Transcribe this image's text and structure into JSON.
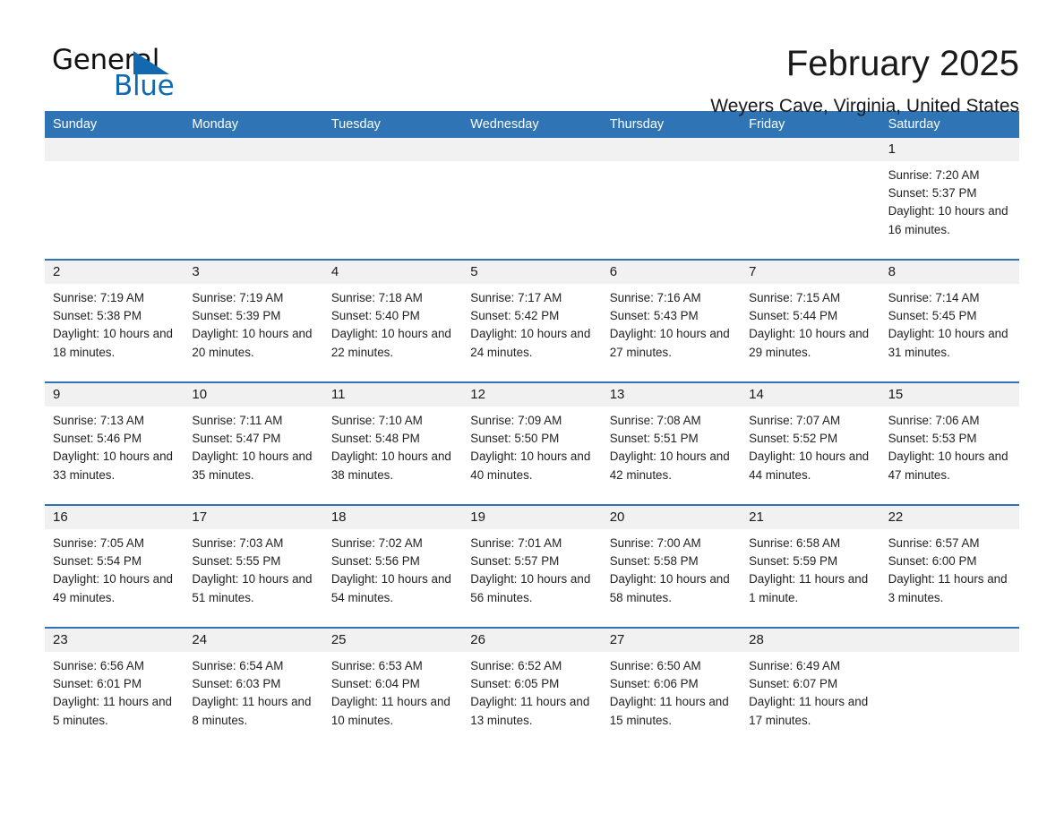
{
  "brand": {
    "name_part1": "General",
    "name_part2": "Blue",
    "logo_icon": "triangle-flag-icon",
    "accent_color": "#1269b0"
  },
  "header": {
    "title": "February 2025",
    "subtitle": "Weyers Cave, Virginia, United States"
  },
  "theme": {
    "header_row_bg": "#2f74b5",
    "day_number_bg": "#f1f1f1",
    "row_divider": "#2f74b5",
    "text": "#1a1a1a"
  },
  "weekdays": [
    "Sunday",
    "Monday",
    "Tuesday",
    "Wednesday",
    "Thursday",
    "Friday",
    "Saturday"
  ],
  "weeks": [
    [
      {
        "day": "",
        "empty": true
      },
      {
        "day": "",
        "empty": true
      },
      {
        "day": "",
        "empty": true
      },
      {
        "day": "",
        "empty": true
      },
      {
        "day": "",
        "empty": true
      },
      {
        "day": "",
        "empty": true
      },
      {
        "day": "1",
        "sunrise": "Sunrise: 7:20 AM",
        "sunset": "Sunset: 5:37 PM",
        "daylight": "Daylight: 10 hours and 16 minutes."
      }
    ],
    [
      {
        "day": "2",
        "sunrise": "Sunrise: 7:19 AM",
        "sunset": "Sunset: 5:38 PM",
        "daylight": "Daylight: 10 hours and 18 minutes."
      },
      {
        "day": "3",
        "sunrise": "Sunrise: 7:19 AM",
        "sunset": "Sunset: 5:39 PM",
        "daylight": "Daylight: 10 hours and 20 minutes."
      },
      {
        "day": "4",
        "sunrise": "Sunrise: 7:18 AM",
        "sunset": "Sunset: 5:40 PM",
        "daylight": "Daylight: 10 hours and 22 minutes."
      },
      {
        "day": "5",
        "sunrise": "Sunrise: 7:17 AM",
        "sunset": "Sunset: 5:42 PM",
        "daylight": "Daylight: 10 hours and 24 minutes."
      },
      {
        "day": "6",
        "sunrise": "Sunrise: 7:16 AM",
        "sunset": "Sunset: 5:43 PM",
        "daylight": "Daylight: 10 hours and 27 minutes."
      },
      {
        "day": "7",
        "sunrise": "Sunrise: 7:15 AM",
        "sunset": "Sunset: 5:44 PM",
        "daylight": "Daylight: 10 hours and 29 minutes."
      },
      {
        "day": "8",
        "sunrise": "Sunrise: 7:14 AM",
        "sunset": "Sunset: 5:45 PM",
        "daylight": "Daylight: 10 hours and 31 minutes."
      }
    ],
    [
      {
        "day": "9",
        "sunrise": "Sunrise: 7:13 AM",
        "sunset": "Sunset: 5:46 PM",
        "daylight": "Daylight: 10 hours and 33 minutes."
      },
      {
        "day": "10",
        "sunrise": "Sunrise: 7:11 AM",
        "sunset": "Sunset: 5:47 PM",
        "daylight": "Daylight: 10 hours and 35 minutes."
      },
      {
        "day": "11",
        "sunrise": "Sunrise: 7:10 AM",
        "sunset": "Sunset: 5:48 PM",
        "daylight": "Daylight: 10 hours and 38 minutes."
      },
      {
        "day": "12",
        "sunrise": "Sunrise: 7:09 AM",
        "sunset": "Sunset: 5:50 PM",
        "daylight": "Daylight: 10 hours and 40 minutes."
      },
      {
        "day": "13",
        "sunrise": "Sunrise: 7:08 AM",
        "sunset": "Sunset: 5:51 PM",
        "daylight": "Daylight: 10 hours and 42 minutes."
      },
      {
        "day": "14",
        "sunrise": "Sunrise: 7:07 AM",
        "sunset": "Sunset: 5:52 PM",
        "daylight": "Daylight: 10 hours and 44 minutes."
      },
      {
        "day": "15",
        "sunrise": "Sunrise: 7:06 AM",
        "sunset": "Sunset: 5:53 PM",
        "daylight": "Daylight: 10 hours and 47 minutes."
      }
    ],
    [
      {
        "day": "16",
        "sunrise": "Sunrise: 7:05 AM",
        "sunset": "Sunset: 5:54 PM",
        "daylight": "Daylight: 10 hours and 49 minutes."
      },
      {
        "day": "17",
        "sunrise": "Sunrise: 7:03 AM",
        "sunset": "Sunset: 5:55 PM",
        "daylight": "Daylight: 10 hours and 51 minutes."
      },
      {
        "day": "18",
        "sunrise": "Sunrise: 7:02 AM",
        "sunset": "Sunset: 5:56 PM",
        "daylight": "Daylight: 10 hours and 54 minutes."
      },
      {
        "day": "19",
        "sunrise": "Sunrise: 7:01 AM",
        "sunset": "Sunset: 5:57 PM",
        "daylight": "Daylight: 10 hours and 56 minutes."
      },
      {
        "day": "20",
        "sunrise": "Sunrise: 7:00 AM",
        "sunset": "Sunset: 5:58 PM",
        "daylight": "Daylight: 10 hours and 58 minutes."
      },
      {
        "day": "21",
        "sunrise": "Sunrise: 6:58 AM",
        "sunset": "Sunset: 5:59 PM",
        "daylight": "Daylight: 11 hours and 1 minute."
      },
      {
        "day": "22",
        "sunrise": "Sunrise: 6:57 AM",
        "sunset": "Sunset: 6:00 PM",
        "daylight": "Daylight: 11 hours and 3 minutes."
      }
    ],
    [
      {
        "day": "23",
        "sunrise": "Sunrise: 6:56 AM",
        "sunset": "Sunset: 6:01 PM",
        "daylight": "Daylight: 11 hours and 5 minutes."
      },
      {
        "day": "24",
        "sunrise": "Sunrise: 6:54 AM",
        "sunset": "Sunset: 6:03 PM",
        "daylight": "Daylight: 11 hours and 8 minutes."
      },
      {
        "day": "25",
        "sunrise": "Sunrise: 6:53 AM",
        "sunset": "Sunset: 6:04 PM",
        "daylight": "Daylight: 11 hours and 10 minutes."
      },
      {
        "day": "26",
        "sunrise": "Sunrise: 6:52 AM",
        "sunset": "Sunset: 6:05 PM",
        "daylight": "Daylight: 11 hours and 13 minutes."
      },
      {
        "day": "27",
        "sunrise": "Sunrise: 6:50 AM",
        "sunset": "Sunset: 6:06 PM",
        "daylight": "Daylight: 11 hours and 15 minutes."
      },
      {
        "day": "28",
        "sunrise": "Sunrise: 6:49 AM",
        "sunset": "Sunset: 6:07 PM",
        "daylight": "Daylight: 11 hours and 17 minutes."
      },
      {
        "day": "",
        "empty": true
      }
    ]
  ]
}
